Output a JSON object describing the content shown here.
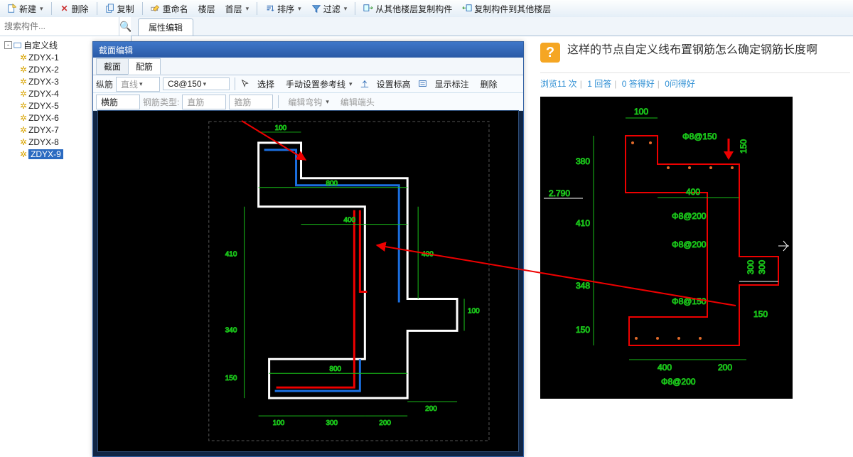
{
  "toolbar": {
    "new": "新建",
    "delete": "删除",
    "copy": "复制",
    "rename": "重命名",
    "floor": "楼层",
    "first_floor": "首层",
    "sort": "排序",
    "filter": "过滤",
    "copy_from_other": "从其他楼层复制构件",
    "copy_to_other": "复制构件到其他楼层"
  },
  "search": {
    "placeholder": "搜索构件..."
  },
  "tree": {
    "root": "自定义线",
    "items": [
      "ZDYX-1",
      "ZDYX-2",
      "ZDYX-3",
      "ZDYX-4",
      "ZDYX-5",
      "ZDYX-6",
      "ZDYX-7",
      "ZDYX-8",
      "ZDYX-9"
    ],
    "selected": 8
  },
  "main_tab": "属性编辑",
  "floatwin": {
    "title": "截面编辑",
    "tabs": [
      "截面",
      "配筋"
    ],
    "active_tab": 1,
    "bar1": {
      "zongjin": "纵筋",
      "linetype": "直线",
      "spec": "C8@150",
      "select": "选择",
      "manual_ref": "手动设置参考线",
      "set_elev": "设置标高",
      "show_anno": "显示标注",
      "del": "删除"
    },
    "bar2": {
      "hengjin": "横筋",
      "type_label": "钢筋类型:",
      "straight": "直筋",
      "stirrup": "箍筋",
      "edit_hook": "编辑弯钩",
      "edit_end": "编辑端头"
    },
    "canvas_dims": {
      "top": [
        "100"
      ],
      "upper": [
        "800"
      ],
      "left": [
        "410",
        "340",
        "150"
      ],
      "right": [
        "400"
      ],
      "bottom": [
        "100",
        "300",
        "200"
      ],
      "inner_bottom": [
        "800"
      ],
      "notch_right": [
        "100",
        "200"
      ]
    }
  },
  "question": {
    "title": "这样的节点自定义线布置钢筋怎么确定钢筋长度啊",
    "views": "浏览11 次",
    "answers": "1 回答",
    "good_a": "0 答得好",
    "good_q": "0问得好"
  },
  "ref": {
    "top_dim": "100",
    "spec_top": "Φ8@150",
    "left_elev": "2.790",
    "dims_left": [
      "380",
      "410",
      "348",
      "150"
    ],
    "dims_right": [
      "150",
      "300",
      "300",
      "150"
    ],
    "inner": [
      "400",
      "Φ8@200",
      "Φ8@200",
      "Φ8@150"
    ],
    "bottom": [
      "400",
      "200",
      "Φ8@200"
    ]
  }
}
